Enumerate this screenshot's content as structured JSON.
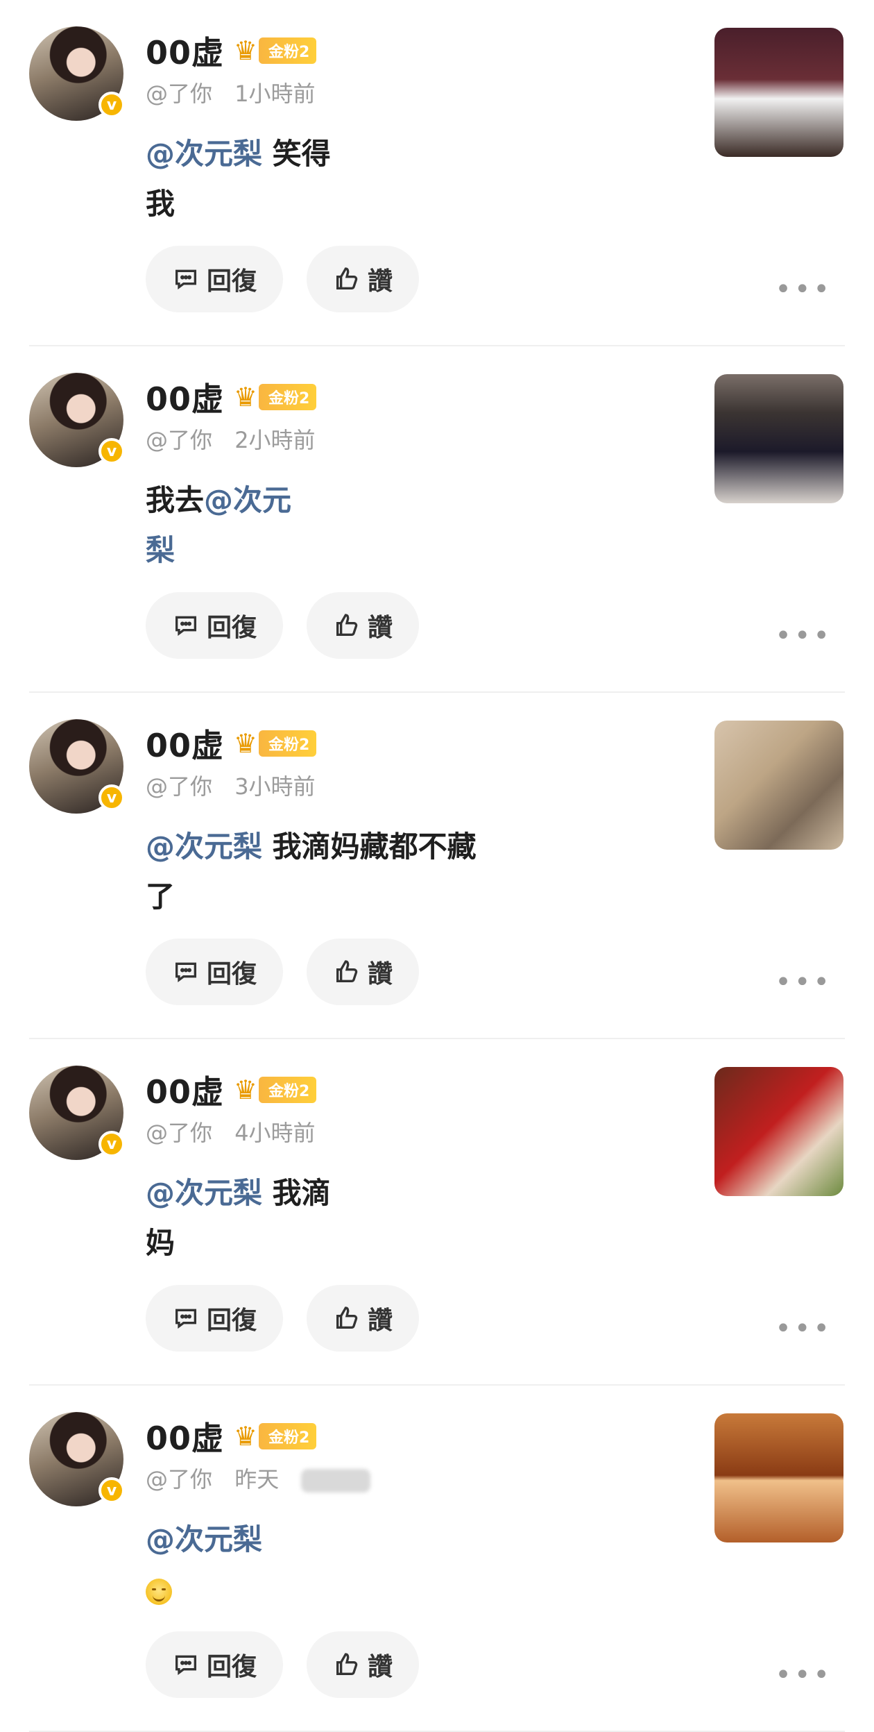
{
  "comments": [
    {
      "name": "00虚",
      "fan_label": "金粉2",
      "handle": "@了你",
      "time": "1小時前",
      "mention": "@次元梨",
      "text": " 笑得",
      "text2": "我",
      "reply_label": "回復",
      "like_label": "讚"
    },
    {
      "name": "00虚",
      "fan_label": "金粉2",
      "handle": "@了你",
      "time": "2小時前",
      "pre": "我去",
      "mention": "@次元",
      "mention2": "梨",
      "reply_label": "回復",
      "like_label": "讚"
    },
    {
      "name": "00虚",
      "fan_label": "金粉2",
      "handle": "@了你",
      "time": "3小時前",
      "mention": "@次元梨",
      "text": " 我滴妈藏都不藏",
      "text2": "了",
      "reply_label": "回復",
      "like_label": "讚"
    },
    {
      "name": "00虚",
      "fan_label": "金粉2",
      "handle": "@了你",
      "time": "4小時前",
      "mention": "@次元梨",
      "text": " 我滴",
      "text2": "妈",
      "reply_label": "回復",
      "like_label": "讚"
    },
    {
      "name": "00虚",
      "fan_label": "金粉2",
      "handle": "@了你",
      "time": "昨天",
      "mention": "@次元梨",
      "emoji": "smiling-face",
      "reply_label": "回復",
      "like_label": "讚"
    }
  ],
  "colors": {
    "mention": "#4a6a94",
    "badge": "#f7b500",
    "button_bg": "#f4f4f4"
  },
  "icons": {
    "reply": "comment-bubble-icon",
    "like": "thumbs-up-icon",
    "more": "more-dots-icon",
    "verified": "verified-v-icon",
    "crown": "crown-icon"
  }
}
